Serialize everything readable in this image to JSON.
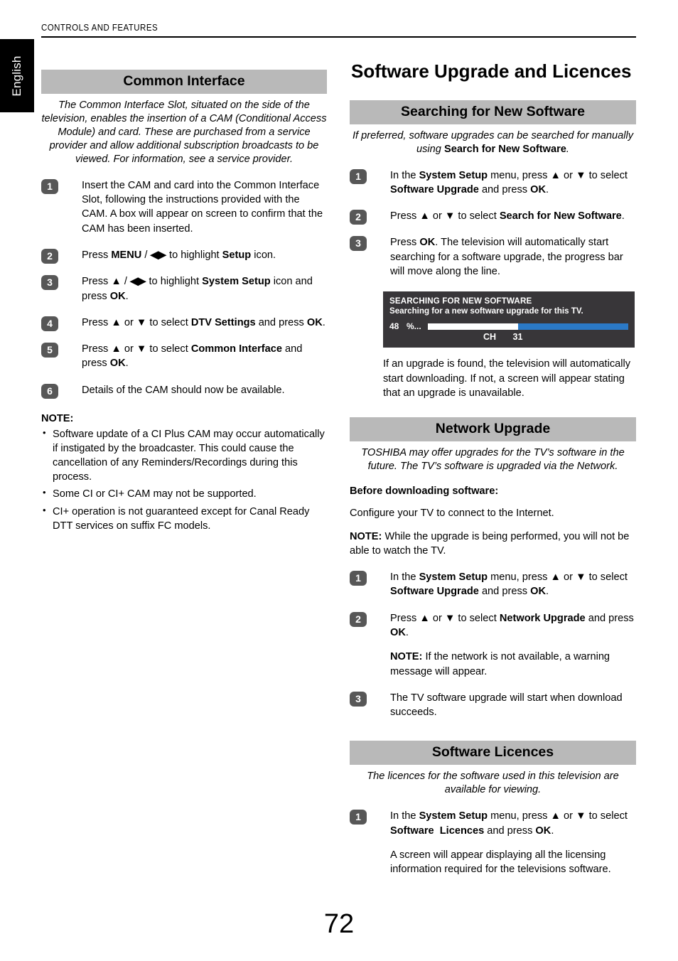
{
  "header": {
    "running_head": "CONTROLS AND FEATURES",
    "language_tab": "English"
  },
  "folio": {
    "page_number": "72"
  },
  "left_column": {
    "section_heading": "Common Interface",
    "intro": "The Common Interface Slot, situated on the side of the television, enables the insertion of a CAM (Conditional Access Module) and card. These are purchased from a service provider and allow additional subscription broadcasts to be viewed. For information, see a service provider.",
    "steps": [
      {
        "number": "1",
        "text_html": "Insert the CAM and card into the Common Interface Slot, following the instructions provided with the CAM. A box will appear on screen to confirm that the CAM has been inserted."
      },
      {
        "number": "2",
        "text_html": "Press <b>MENU</b> / <b>◀▶</b> to highlight <b>Setup</b> icon."
      },
      {
        "number": "3",
        "text_html": "Press <b>▲</b> / <b>◀▶</b> to highlight <b>System Setup</b> icon and press <b>OK</b>."
      },
      {
        "number": "4",
        "text_html": "Press <b>▲</b> or <b>▼</b> to select <b>DTV Settings</b> and press <b>OK</b>."
      },
      {
        "number": "5",
        "text_html": "Press <b>▲</b> or <b>▼</b> to select <b>Common Interface</b> and press <b>OK</b>."
      },
      {
        "number": "6",
        "text_html": "Details of the CAM should now be available."
      }
    ],
    "note_heading": "NOTE:",
    "notes": [
      "Software update of a CI Plus CAM may occur automatically if instigated by the broadcaster. This could cause the cancellation of any Reminders/Recordings during this process.",
      "Some CI or CI+ CAM may not be supported.",
      "CI+ operation is not guaranteed except for Canal Ready DTT services on suffix FC models."
    ]
  },
  "right_column": {
    "page_title": "Software Upgrade and Licences",
    "sections": [
      {
        "heading": "Searching for New Software",
        "intro_html": "If preferred, software upgrades can be searched for manually using <b>Search for New Software</b>.",
        "steps": [
          {
            "number": "1",
            "text_html": "In the <b>System Setup</b> menu, press <b>▲</b> or <b>▼</b> to select <b>Software Upgrade</b> and press <b>OK</b>."
          },
          {
            "number": "2",
            "text_html": "Press <b>▲</b> or <b>▼</b> to select <b>Search for New Software</b>."
          },
          {
            "number": "3",
            "text_html": "Press <b>OK</b>. The television will automatically start searching for a software upgrade, the progress bar will move along the line."
          }
        ],
        "osd": {
          "title": "SEARCHING FOR NEW SOFTWARE",
          "subtitle": "Searching for a new software upgrade for this TV.",
          "percent_value": "48",
          "percent_mark": "%...",
          "progress_percent": 45,
          "channel_label": "CH",
          "channel_number": "31",
          "background_color": "#383639",
          "bar_done_color": "#ffffff",
          "bar_remaining_color": "#2b79c6"
        },
        "after_osd_text": "If an upgrade is found, the television will automatically start downloading. If not, a screen will appear stating that an upgrade is unavailable."
      },
      {
        "heading": "Network Upgrade",
        "intro": "TOSHIBA may offer upgrades for the TV’s software in the future. The TV’s software is upgraded via the Network.",
        "before_heading": "Before downloading software:",
        "before_text": "Configure your TV to connect to the Internet.",
        "note_html": "<b>NOTE:</b> While the upgrade is being performed, you will not be able to watch the TV.",
        "steps": [
          {
            "number": "1",
            "text_html": "In the <b>System Setup</b> menu, press <b>▲</b> or <b>▼</b> to select <b>Software Upgrade</b> and press <b>OK</b>."
          },
          {
            "number": "2",
            "text_html": "Press <b>▲</b> or <b>▼</b> to select <b>Network Upgrade</b> and press <b>OK</b>.",
            "extra_html": "<b>NOTE:</b> If the network is not available, a warning message will appear."
          },
          {
            "number": "3",
            "text_html": "The TV software upgrade will start when download succeeds."
          }
        ]
      },
      {
        "heading": "Software Licences",
        "intro": "The licences for the software used in this television are available for viewing.",
        "steps": [
          {
            "number": "1",
            "text_html": "In the <b>System Setup</b> menu, press <b>▲</b> or <b>▼</b> to select <b>Software&nbsp; Licences</b> and press <b>OK</b>.",
            "extra_html": "A screen will appear displaying all the licensing information required for the televisions software."
          }
        ]
      }
    ]
  },
  "colors": {
    "heading_bar": "#b9b9b9",
    "step_badge": "#575757",
    "tab_background": "#000000"
  }
}
